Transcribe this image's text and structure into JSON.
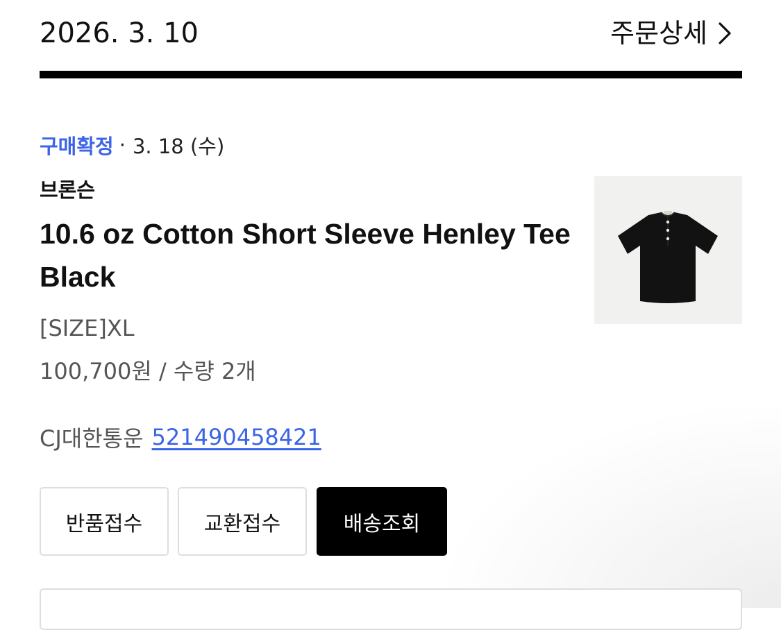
{
  "header": {
    "order_date": "2026. 3. 10",
    "order_detail_label": "주문상세"
  },
  "status": {
    "label": "구매확정",
    "separator": "·",
    "date": "3. 18 (수)",
    "label_color": "#3c64e6"
  },
  "product": {
    "brand": "브론슨",
    "name": "10.6 oz Cotton Short Sleeve Henley Tee Black",
    "option": "[SIZE]XL",
    "price_qty": "100,700원 / 수량 2개",
    "thumbnail_icon": "black-henley-tee-image"
  },
  "shipping": {
    "carrier": "CJ대한통운",
    "tracking_number": "521490458421",
    "link_color": "#3c64e6"
  },
  "actions": {
    "return_label": "반품접수",
    "exchange_label": "교환접수",
    "track_label": "배송조회"
  },
  "icons": {
    "detail_chevron": "chevron-right-icon"
  }
}
